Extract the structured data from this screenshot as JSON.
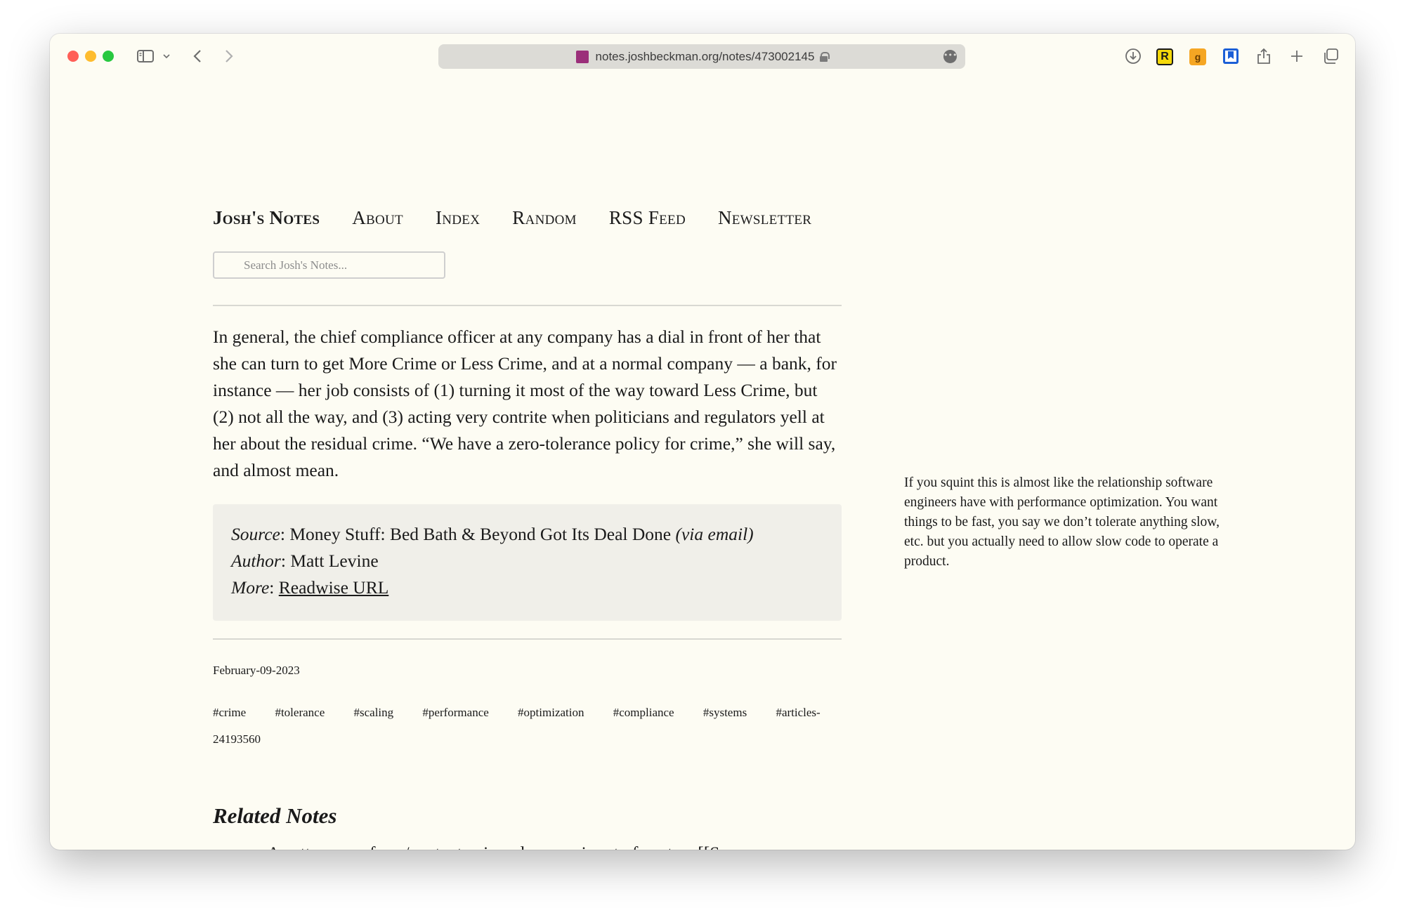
{
  "browser": {
    "url": "notes.joshbeckman.org/notes/473002145",
    "more_glyph": "•••",
    "extensions": [
      {
        "letter": "R",
        "bg": "#f5d90a",
        "fg": "#1a1a1a"
      },
      {
        "letter": "g",
        "bg": "#f5a623",
        "fg": "#6b3d00"
      }
    ]
  },
  "nav": {
    "brand": "Josh's Notes",
    "items": [
      "About",
      "Index",
      "Random",
      "RSS Feed",
      "Newsletter"
    ]
  },
  "search": {
    "placeholder": "Search Josh's Notes..."
  },
  "note": {
    "body": "In general, the chief compliance officer at any company has a dial in front of her that she can turn to get More Crime or Less Crime, and at a normal company — a bank, for instance — her job consists of (1) turning it most of the way toward Less Crime, but (2) not all the way, and (3) acting very contrite when politicians and regulators yell at her about the residual crime. “We have a zero-tolerance policy for crime,” she will say, and almost mean.",
    "source_label": "Source",
    "source_value": "Money Stuff: Bed Bath & Beyond Got Its Deal Done ",
    "source_via": "(via email)",
    "author_label": "Author",
    "author_value": "Matt Levine",
    "more_label": "More",
    "more_link": "Readwise URL",
    "date": "February-09-2023",
    "tags": [
      "#crime",
      "#tolerance",
      "#scaling",
      "#performance",
      "#optimization",
      "#compliance",
      "#systems",
      "#articles-24193560"
    ]
  },
  "sidenote": "If you squint this is almost like the relationship software engineers have with performance optimization. You want things to be fast, you say we don’t tolerate anything slow, etc. but you actually need to allow slow code to operate a product.",
  "related": {
    "title": "Related Notes",
    "arrow": "➞",
    "items": [
      "A pattern as a form/context pair and a generic set of centers [[Some"
    ]
  }
}
